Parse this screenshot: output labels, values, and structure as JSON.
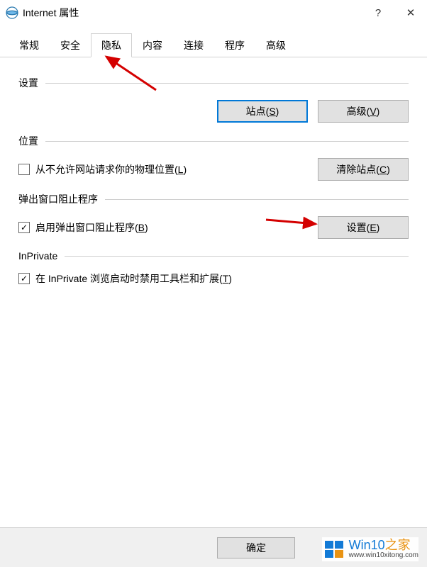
{
  "window": {
    "title": "Internet 属性",
    "help": "?",
    "close": "✕"
  },
  "tabs": {
    "items": [
      {
        "label": "常规"
      },
      {
        "label": "安全"
      },
      {
        "label": "隐私"
      },
      {
        "label": "内容"
      },
      {
        "label": "连接"
      },
      {
        "label": "程序"
      },
      {
        "label": "高级"
      }
    ],
    "active_index": 2
  },
  "sections": {
    "settings": {
      "label": "设置",
      "sites_btn": "站点(",
      "sites_key": "S",
      "sites_btn_end": ")",
      "advanced_btn": "高级(",
      "advanced_key": "V",
      "advanced_btn_end": ")"
    },
    "location": {
      "label": "位置",
      "checkbox_text_pre": "从不允许网站请求你的物理位置(",
      "checkbox_key": "L",
      "checkbox_text_end": ")",
      "checked": false,
      "clear_btn": "清除站点(",
      "clear_key": "C",
      "clear_btn_end": ")"
    },
    "popup": {
      "label": "弹出窗口阻止程序",
      "checkbox_text_pre": "启用弹出窗口阻止程序(",
      "checkbox_key": "B",
      "checkbox_text_end": ")",
      "checked": true,
      "settings_btn": "设置(",
      "settings_key": "E",
      "settings_btn_end": ")"
    },
    "inprivate": {
      "label": "InPrivate",
      "checkbox_text_pre": "在 InPrivate 浏览启动时禁用工具栏和扩展(",
      "checkbox_key": "T",
      "checkbox_text_end": ")",
      "checked": true
    }
  },
  "bottom": {
    "ok": "确定"
  },
  "watermark": {
    "main_pre": "Win10",
    "main_post": "之家",
    "sub": "www.win10xitong.com"
  }
}
